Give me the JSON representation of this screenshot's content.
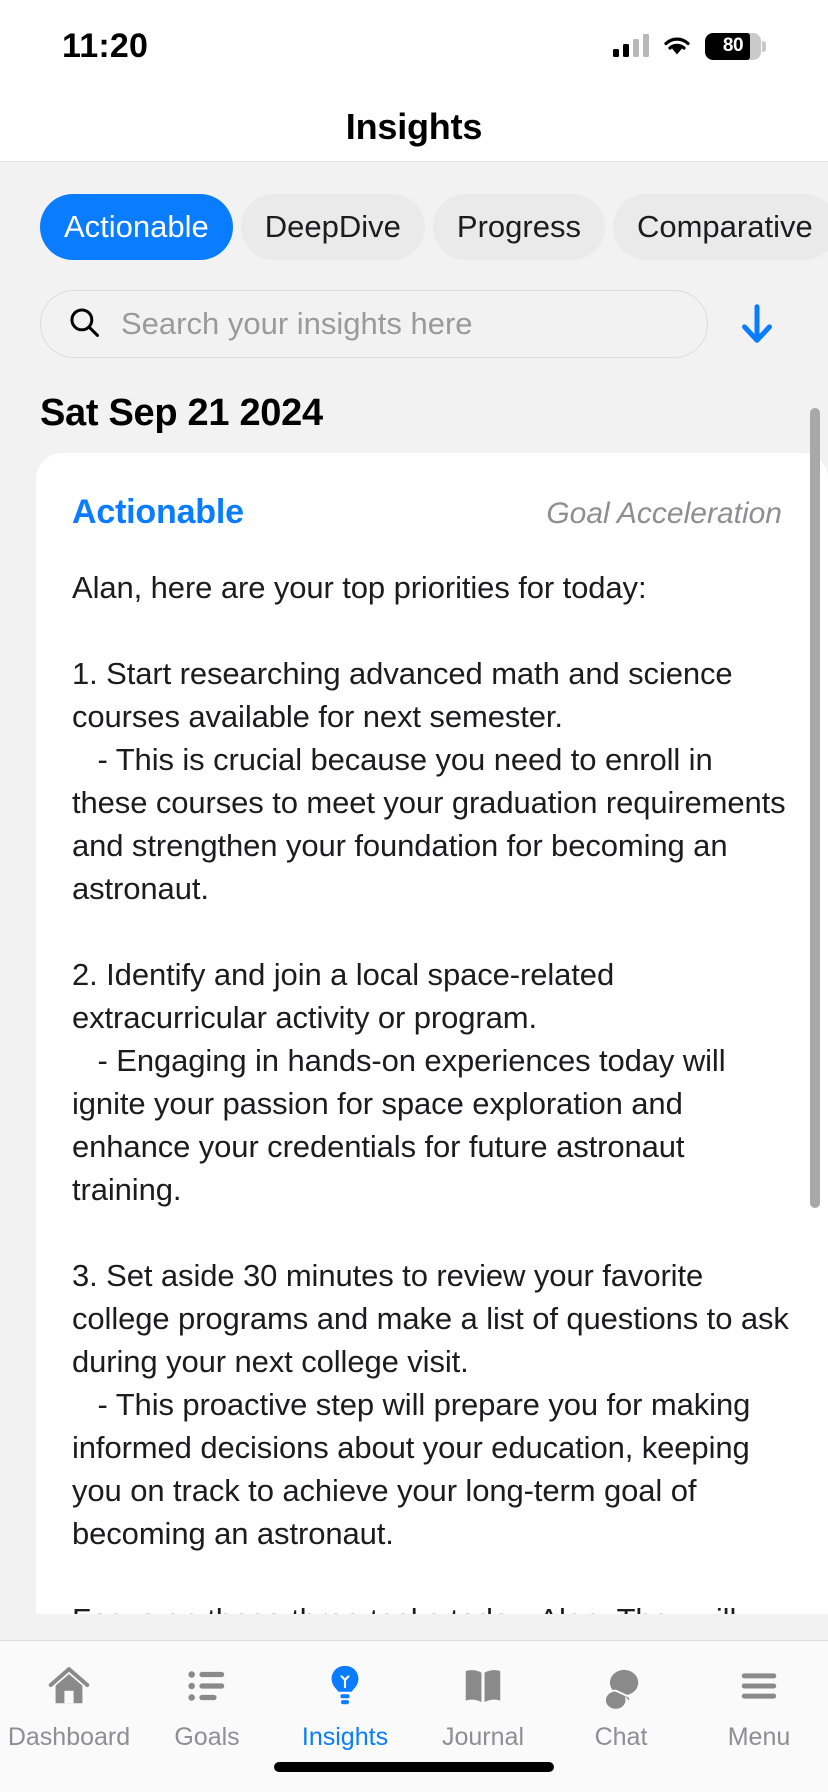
{
  "status_bar": {
    "time": "11:20",
    "battery_percent": "80",
    "cellular_icon": "cellular-signal-icon",
    "wifi_icon": "wifi-icon",
    "battery_icon": "battery-icon"
  },
  "header": {
    "title": "Insights"
  },
  "filters": {
    "tabs": [
      {
        "label": "Actionable",
        "active": true
      },
      {
        "label": "DeepDive",
        "active": false
      },
      {
        "label": "Progress",
        "active": false
      },
      {
        "label": "Comparative",
        "active": false
      }
    ]
  },
  "search": {
    "placeholder": "Search your insights here",
    "icon": "search-icon",
    "sort_icon": "arrow-down-icon"
  },
  "feed": {
    "date_header": "Sat Sep 21 2024",
    "card": {
      "type": "Actionable",
      "tag": "Goal Acceleration",
      "body": "Alan, here are your top priorities for today:\n\n1. Start researching advanced math and science courses available for next semester.\n   - This is crucial because you need to enroll in these courses to meet your graduation requirements and strengthen your foundation for becoming an astronaut.\n\n2. Identify and join a local space-related extracurricular activity or program.\n   - Engaging in hands-on experiences today will ignite your passion for space exploration and enhance your credentials for future astronaut training.\n\n3. Set aside 30 minutes to review your favorite college programs and make a list of questions to ask during your next college visit.\n   - This proactive step will prepare you for making informed decisions about your education, keeping you on track to achieve your long-term goal of becoming an astronaut.\n\nFocus on these three tasks today, Alan. They will significantly advance your educational journey and align with your ambitious"
    }
  },
  "tabbar": {
    "items": [
      {
        "label": "Dashboard",
        "icon": "home-icon",
        "active": false
      },
      {
        "label": "Goals",
        "icon": "list-icon",
        "active": false
      },
      {
        "label": "Insights",
        "icon": "lightbulb-icon",
        "active": true
      },
      {
        "label": "Journal",
        "icon": "book-icon",
        "active": false
      },
      {
        "label": "Chat",
        "icon": "chat-bubbles-icon",
        "active": false
      },
      {
        "label": "Menu",
        "icon": "hamburger-icon",
        "active": false
      }
    ]
  },
  "colors": {
    "accent": "#0a7cff",
    "background": "#f2f2f2",
    "card": "#ffffff",
    "muted": "#8e8e93"
  }
}
